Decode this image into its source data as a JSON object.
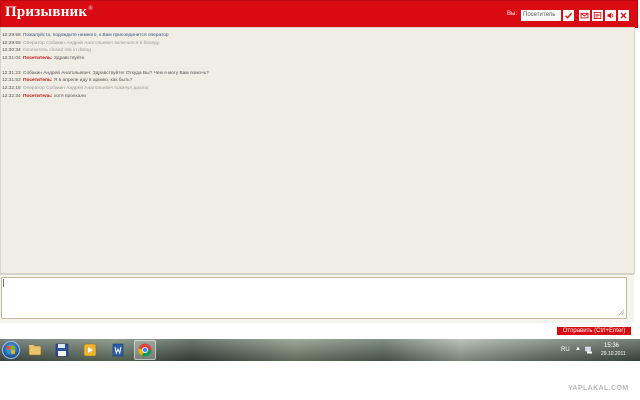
{
  "header": {
    "logo": "Призывник",
    "logo_mark": "®",
    "you_label": "Вы:",
    "visitor_value": "Посетитель",
    "colors": {
      "brand_red": "#d90a12"
    },
    "icons": [
      "check-icon",
      "mail-icon",
      "history-icon",
      "sound-icon",
      "close-icon"
    ]
  },
  "chat": {
    "messages": [
      {
        "time": "12:29:58",
        "sender": "",
        "text": "Пожалуйста, подождите немного, к Вам присоединится оператор",
        "style": "blue"
      },
      {
        "time": "12:29:59",
        "sender": "",
        "text": "Оператор Собакин Андрей Анатольевич включился в беседу.",
        "style": "gray"
      },
      {
        "time": "12:30:34",
        "sender": "",
        "text": "посетитель closed link in dialog",
        "style": "gray"
      },
      {
        "time": "12:31:04",
        "sender": "Посетитель:",
        "text": "Здравствуйте",
        "style": "visitor"
      },
      {
        "time": "12:31:23",
        "sender": "",
        "text": "Собакин Андрей Анатольевич: Здравствуйте! Откуда Вы? Чем я могу Вам помочь?",
        "style": "operator"
      },
      {
        "time": "12:31:53",
        "sender": "Посетитель:",
        "text": "Я в апреле иду в армию, как быть?",
        "style": "visitor"
      },
      {
        "time": "12:32:18",
        "sender": "",
        "text": "Оператор Собакин Андрей Анатольевич покинул диалог",
        "style": "gray"
      },
      {
        "time": "12:32:34",
        "sender": "Посетитель:",
        "text": "хотя проехали",
        "style": "visitor"
      }
    ]
  },
  "composer": {
    "value": "",
    "send_label": "Отправить (Ctrl+Enter)"
  },
  "taskbar": {
    "apps": [
      "start-button",
      "explorer-icon",
      "floppy-icon",
      "media-player-icon",
      "word-icon",
      "chrome-icon"
    ],
    "lang": "RU",
    "time": "15:36",
    "date": "29.10.2011"
  },
  "watermark": "YAPLAKAL.COM"
}
